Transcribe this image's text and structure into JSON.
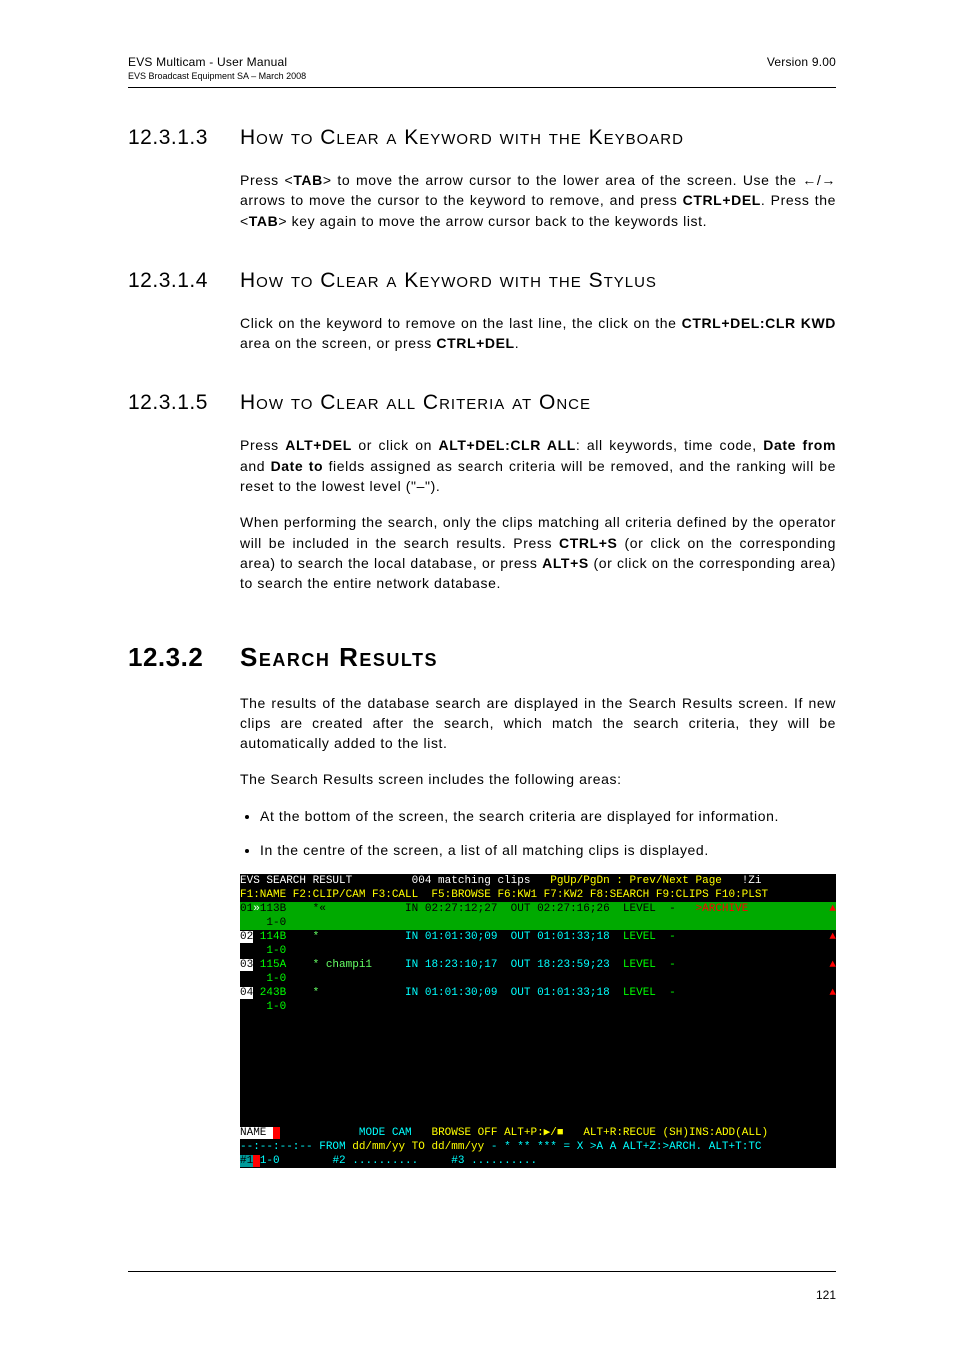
{
  "header": {
    "left_line1": "EVS Multicam - User Manual",
    "left_line2": "EVS Broadcast Equipment SA – March 2008",
    "right": "Version 9.00"
  },
  "sections": [
    {
      "num": "12.3.1.3",
      "title": "How to Clear a Keyword with the Keyboard",
      "paras": [
        "Press <<b>TAB</b>> to move the arrow cursor to the lower area of the screen. Use the ←/→ arrows to move the cursor to the keyword to remove, and press <b>CTRL+DEL</b>. Press the <<b>TAB</b>> key again to move the arrow cursor back to the keywords list."
      ]
    },
    {
      "num": "12.3.1.4",
      "title": "How to Clear a Keyword with the Stylus",
      "paras": [
        "Click on the keyword to remove on the last line, the click on the <b>CTRL+DEL:CLR KWD</b> area on the screen, or press <b>CTRL+DEL</b>."
      ]
    },
    {
      "num": "12.3.1.5",
      "title": "How to Clear all Criteria at Once",
      "paras": [
        "Press <b>ALT+DEL</b> or click on <b>ALT+DEL:CLR ALL</b>: all keywords, time code, <b>Date from</b> and <b>Date to</b> fields assigned as search criteria will be removed, and the ranking will be reset to the lowest level (\"–\").",
        "When performing the search, only the clips matching all criteria defined by the operator will be included in the search results. Press <b>CTRL+S</b> (or click on the corresponding area) to search the local database, or press <b>ALT+S</b> (or click on the corresponding area) to search the entire network database."
      ]
    }
  ],
  "section_big": {
    "num": "12.3.2",
    "title": "Search Results",
    "paras": [
      "The results of the database search are displayed in the Search Results screen. If new clips are created after the search, which match the search criteria, they will be automatically added to the list.",
      "The Search Results screen includes the following areas:"
    ],
    "bullets": [
      "At the bottom of the screen, the search criteria are displayed for information.",
      "In the centre of the screen, a list of all matching clips is displayed."
    ]
  },
  "terminal": {
    "top1": {
      "left": "EVS SEARCH RESULT",
      "mid": "004 matching clips",
      "right": "PgUp/PgDn : Prev/Next Page",
      "tail": "!Zi"
    },
    "fkeys": "F1:NAME F2:CLIP/CAM F3:CALL  F5:BROWSE F6:KW1 F7:KW2 F8:SEARCH F9:CLIPS F10:PLST",
    "rows": [
      {
        "n": "01",
        "id": "113B",
        "sub": "1-0",
        "name": "*«",
        "in": "02:27:12;27",
        "out": "02:27:16;26",
        "lvl": "LEVEL  -",
        "arch": ">ARCHIVE",
        "hl": true
      },
      {
        "n": "02",
        "id": "114B",
        "sub": "1-0",
        "name": "*",
        "in": "01:01:30;09",
        "out": "01:01:33;18",
        "lvl": "LEVEL  -",
        "arch": "",
        "hl": false
      },
      {
        "n": "03",
        "id": "115A",
        "sub": "1-0",
        "name": "* champi1",
        "in": "18:23:10;17",
        "out": "18:23:59;23",
        "lvl": "LEVEL  -",
        "arch": "",
        "hl": false
      },
      {
        "n": "04",
        "id": "243B",
        "sub": "1-0",
        "name": "*",
        "in": "01:01:30;09",
        "out": "01:01:33;18",
        "lvl": "LEVEL  -",
        "arch": "",
        "hl": false
      }
    ],
    "bottom": {
      "l1_left": "NAME ",
      "l1_mode": "MODE CAM",
      "l1_browse": "BROWSE OFF ALT+P:▶/■",
      "l1_right": "ALT+R:RECUE (SH)INS:ADD(ALL)",
      "l2_from": "--:--:--:-- FROM",
      "l2_dates": "dd/mm/yy TO dd/mm/yy",
      "l2_stars": "- * ** ***",
      "l2_right": "= X >A A ALT+Z:>ARCH. ALT+T:TC",
      "l3_left": "#1 1-0",
      "l3_mid": "#2 ..........",
      "l3_right": "#3 .........."
    }
  },
  "page_number": "121"
}
